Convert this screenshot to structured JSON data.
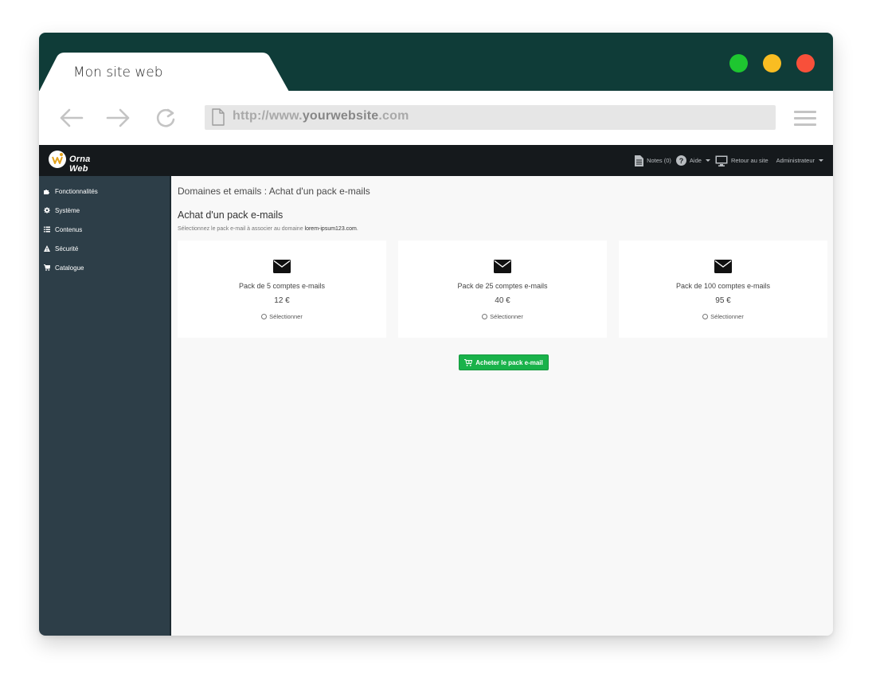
{
  "browser": {
    "tab_title": "Mon site web",
    "url_prefix": "http://www.",
    "url_domain": "yourwebsite",
    "url_suffix": ".com",
    "traffic_lights": {
      "green": "#1ec630",
      "yellow": "#f9bd22",
      "red": "#f8503a"
    },
    "titlebar_color": "#0f3c38"
  },
  "appbar": {
    "logo_text": "Orna Web",
    "notes_label": "Notes (0)",
    "help_label": "Aide",
    "site_label": "Retour au site",
    "user_label": "Administrateur"
  },
  "sidebar": {
    "items": [
      {
        "label": "Fonctionnalités",
        "icon": "puzzle-icon"
      },
      {
        "label": "Système",
        "icon": "gear-icon"
      },
      {
        "label": "Contenus",
        "icon": "list-icon"
      },
      {
        "label": "Sécurité",
        "icon": "warning-icon"
      },
      {
        "label": "Catalogue",
        "icon": "cart-icon"
      }
    ]
  },
  "content": {
    "breadcrumb": "Domaines et emails : Achat d'un pack e-mails",
    "title": "Achat d'un pack e-mails",
    "subtitle_prefix": "Sélectionnez le pack e-mail à associer au domaine ",
    "subtitle_domain": "lorem-ipsum123.com",
    "subtitle_suffix": ".",
    "packs": [
      {
        "title": "Pack de 5 comptes e-mails",
        "price": "12 €",
        "select_label": "Sélectionner"
      },
      {
        "title": "Pack de 25 comptes e-mails",
        "price": "40 €",
        "select_label": "Sélectionner"
      },
      {
        "title": "Pack de 100 comptes e-mails",
        "price": "95 €",
        "select_label": "Sélectionner"
      }
    ],
    "buy_button": "Acheter le pack e-mail",
    "accent_color": "#19b24a"
  }
}
